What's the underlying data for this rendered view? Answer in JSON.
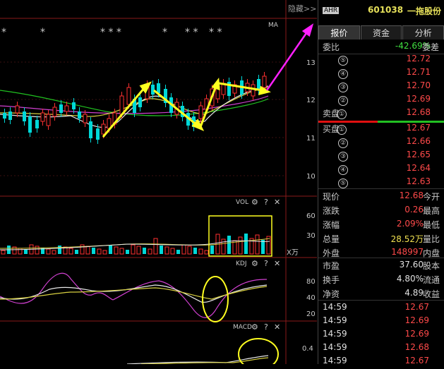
{
  "toolbar": {
    "hide_label": "隐藏>>"
  },
  "chart": {
    "ma_label": "MA",
    "price_ticks": [
      "13",
      "12",
      "11",
      "10"
    ],
    "vol_label": "VOL",
    "vol_ticks": [
      "60",
      "30"
    ],
    "vol_unit": "X万",
    "kdj_label": "KDJ",
    "kdj_ticks": [
      "80",
      "40",
      "20"
    ],
    "macd_label": "MACD",
    "macd_ticks": [
      "0.4"
    ],
    "help": "?",
    "close": "✕",
    "stars": [
      "*",
      "*",
      "* * *",
      "*",
      "* *",
      "* *"
    ]
  },
  "header": {
    "tag": "AHR",
    "code": "601038",
    "name": "一拖股份"
  },
  "tabs": [
    "报价",
    "资金",
    "分析"
  ],
  "quote": {
    "weibi_label": "委比",
    "weibi_value": "-42.69%",
    "weicha_label": "委差",
    "sell_label": "卖盘",
    "buy_label": "买盘",
    "sells": [
      {
        "n": "⑤",
        "price": "12.72"
      },
      {
        "n": "④",
        "price": "12.71"
      },
      {
        "n": "③",
        "price": "12.70"
      },
      {
        "n": "②",
        "price": "12.69"
      },
      {
        "n": "①",
        "price": "12.68"
      }
    ],
    "buys": [
      {
        "n": "①",
        "price": "12.67"
      },
      {
        "n": "②",
        "price": "12.66"
      },
      {
        "n": "③",
        "price": "12.65"
      },
      {
        "n": "④",
        "price": "12.64"
      },
      {
        "n": "⑤",
        "price": "12.63"
      }
    ]
  },
  "stats": [
    {
      "label": "现价",
      "value": "12.68",
      "label2": "今开",
      "color": "#ff4a4a"
    },
    {
      "label": "涨跌",
      "value": "0.26",
      "label2": "最高",
      "color": "#ff4a4a"
    },
    {
      "label": "涨幅",
      "value": "2.09%",
      "label2": "最低",
      "color": "#ff4a4a"
    },
    {
      "label": "总量",
      "value": "28.52万",
      "label2": "量比",
      "color": "#f0e050"
    },
    {
      "label": "外盘",
      "value": "148997",
      "label2": "内盘",
      "color": "#ff4a4a"
    }
  ],
  "stats2": [
    {
      "label": "市盈",
      "value": "37.60",
      "label2": "股本",
      "color": "#e0e0e0"
    },
    {
      "label": "换手",
      "value": "4.80%",
      "label2": "流通",
      "color": "#e0e0e0"
    },
    {
      "label": "净资",
      "value": "4.89",
      "label2": "收益",
      "color": "#e0e0e0"
    }
  ],
  "ticks": [
    {
      "time": "14:59",
      "price": "12.67"
    },
    {
      "time": "14:59",
      "price": "12.69"
    },
    {
      "time": "14:59",
      "price": "12.69"
    },
    {
      "time": "14:59",
      "price": "12.68"
    },
    {
      "time": "14:59",
      "price": "12.67"
    }
  ],
  "colors": {
    "up": "#ff3030",
    "down": "#00d8d8",
    "annotation": "#ffff20",
    "arrow": "#ff20ff"
  }
}
